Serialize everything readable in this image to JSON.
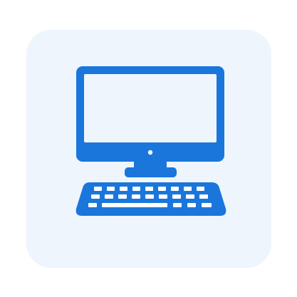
{
  "icon": {
    "name": "desktop-computer-icon",
    "tile_background": "#eef5fd",
    "icon_color": "#1a76db",
    "screen_color": "#eef5fd",
    "key_color": "#ffffff"
  }
}
